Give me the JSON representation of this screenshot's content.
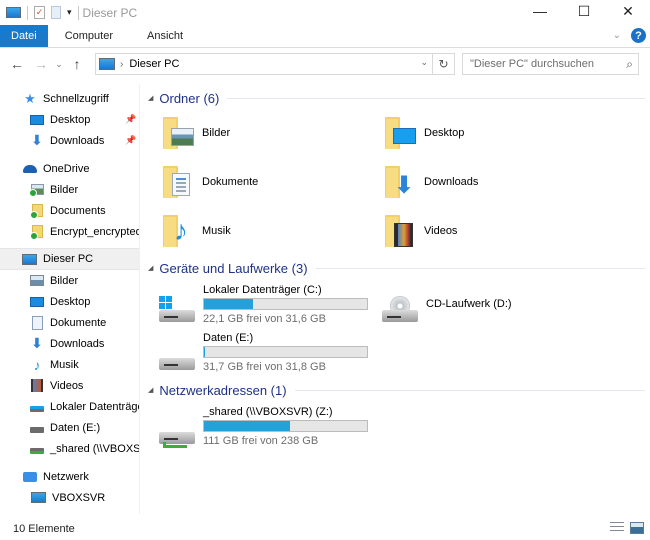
{
  "window": {
    "title": "Dieser PC",
    "controls": {
      "minimize": "—",
      "maximize": "☐",
      "close": "✕"
    }
  },
  "ribbon": {
    "tabs": [
      {
        "label": "Datei",
        "active": true
      },
      {
        "label": "Computer",
        "active": false
      },
      {
        "label": "Ansicht",
        "active": false
      }
    ],
    "help_label": "?"
  },
  "nav": {
    "back": "←",
    "forward": "→",
    "recent": "⌄",
    "up": "↑",
    "breadcrumb": [
      "Dieser PC"
    ],
    "search_placeholder": "\"Dieser PC\" durchsuchen"
  },
  "sidebar": {
    "quick_access": {
      "label": "Schnellzugriff",
      "items": [
        {
          "label": "Desktop",
          "pinned": true
        },
        {
          "label": "Downloads",
          "pinned": true
        }
      ]
    },
    "onedrive": {
      "label": "OneDrive",
      "items": [
        {
          "label": "Bilder"
        },
        {
          "label": "Documents"
        },
        {
          "label": "Encrypt_encrypted"
        }
      ]
    },
    "this_pc": {
      "label": "Dieser PC",
      "selected": true,
      "items": [
        {
          "label": "Bilder"
        },
        {
          "label": "Desktop"
        },
        {
          "label": "Dokumente"
        },
        {
          "label": "Downloads"
        },
        {
          "label": "Musik"
        },
        {
          "label": "Videos"
        },
        {
          "label": "Lokaler Datenträger"
        },
        {
          "label": "Daten (E:)"
        },
        {
          "label": "_shared (\\\\VBOXSVR"
        }
      ]
    },
    "network": {
      "label": "Netzwerk",
      "items": [
        {
          "label": "VBOXSVR"
        }
      ]
    }
  },
  "content": {
    "folders": {
      "title": "Ordner (6)",
      "items": [
        {
          "name": "Bilder",
          "icon": "pictures-folder-icon"
        },
        {
          "name": "Desktop",
          "icon": "desktop-folder-icon"
        },
        {
          "name": "Dokumente",
          "icon": "documents-folder-icon"
        },
        {
          "name": "Downloads",
          "icon": "downloads-folder-icon"
        },
        {
          "name": "Musik",
          "icon": "music-folder-icon"
        },
        {
          "name": "Videos",
          "icon": "videos-folder-icon"
        }
      ]
    },
    "devices": {
      "title": "Geräte und Laufwerke (3)",
      "items": [
        {
          "name": "Lokaler Datenträger (C:)",
          "free_text": "22,1 GB frei von 31,6 GB",
          "used_fraction": 0.3
        },
        {
          "name": "CD-Laufwerk (D:)"
        },
        {
          "name": "Daten (E:)",
          "free_text": "31,7 GB frei von 31,8 GB",
          "used_fraction": 0.003
        }
      ]
    },
    "network_locations": {
      "title": "Netzwerkadressen (1)",
      "items": [
        {
          "name": "_shared (\\\\VBOXSVR) (Z:)",
          "free_text": "111 GB frei von 238 GB",
          "used_fraction": 0.53
        }
      ]
    }
  },
  "status": {
    "item_count": "10 Elemente"
  },
  "colors": {
    "accent": "#1979ca",
    "group_title": "#1e3287",
    "bar_fill": "#26a0da",
    "bar_bg": "#e6e6e6"
  }
}
